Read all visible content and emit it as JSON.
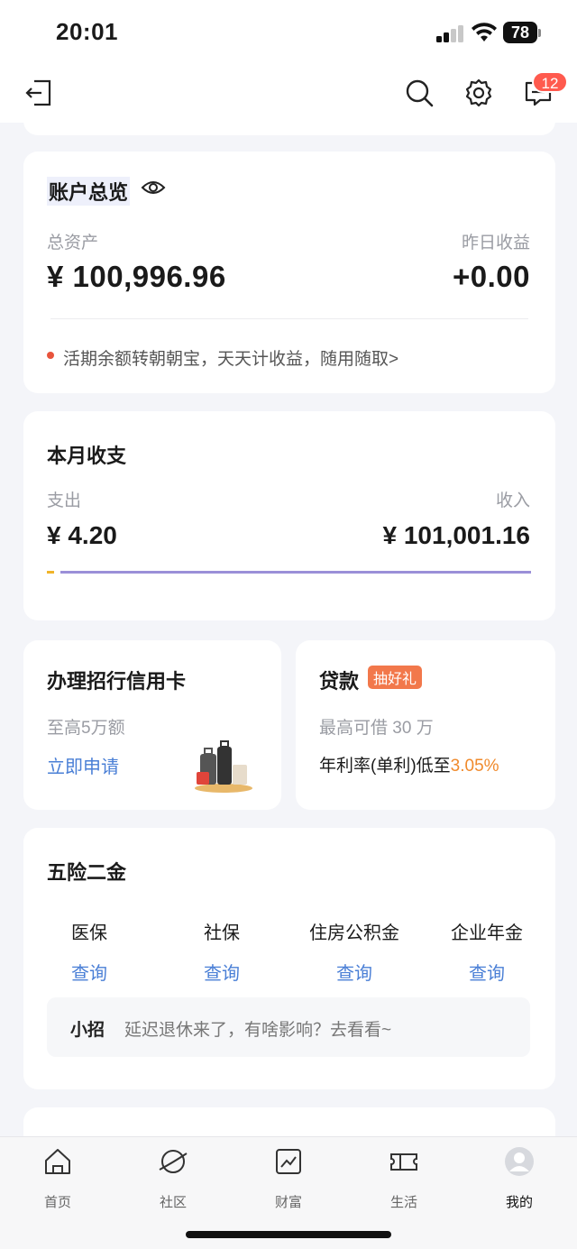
{
  "status_bar": {
    "time": "20:01",
    "battery": "78"
  },
  "nav": {
    "badge_count": "12"
  },
  "overview": {
    "title": "账户总览",
    "total_assets_label": "总资产",
    "total_assets_value": "¥ 100,996.96",
    "yesterday_label": "昨日收益",
    "yesterday_value": "+0.00",
    "tip": "活期余额转朝朝宝，天天计收益，随用随取>"
  },
  "monthly": {
    "title": "本月收支",
    "expense_label": "支出",
    "expense_value": "¥ 4.20",
    "income_label": "收入",
    "income_value": "¥ 101,001.16",
    "expense_ratio": 4e-05
  },
  "credit_card": {
    "title": "办理招行信用卡",
    "subtitle": "至高5万额",
    "action": "立即申请"
  },
  "loan": {
    "title": "贷款",
    "tag": "抽好礼",
    "subtitle": "最高可借 30 万",
    "rate_prefix": "年利率(单利)低至",
    "rate_value": "3.05%"
  },
  "insurance": {
    "title": "五险二金",
    "items": [
      {
        "name": "医保",
        "action": "查询"
      },
      {
        "name": "社保",
        "action": "查询"
      },
      {
        "name": "住房公积金",
        "action": "查询"
      },
      {
        "name": "企业年金",
        "action": "查询"
      }
    ],
    "tip_label": "小招",
    "tip_text": "延迟退休来了，有啥影响？去看看~"
  },
  "tabbar": {
    "items": [
      {
        "label": "首页",
        "icon": "home-icon"
      },
      {
        "label": "社区",
        "icon": "planet-icon"
      },
      {
        "label": "财富",
        "icon": "chart-icon"
      },
      {
        "label": "生活",
        "icon": "ticket-icon"
      },
      {
        "label": "我的",
        "icon": "avatar-icon"
      }
    ]
  },
  "colors": {
    "accent_blue": "#4a7fd6",
    "accent_orange": "#f08a2c",
    "income_bar": "#9b8fd8",
    "expense_bar": "#f0b429",
    "tip_dot": "#e8543c"
  }
}
